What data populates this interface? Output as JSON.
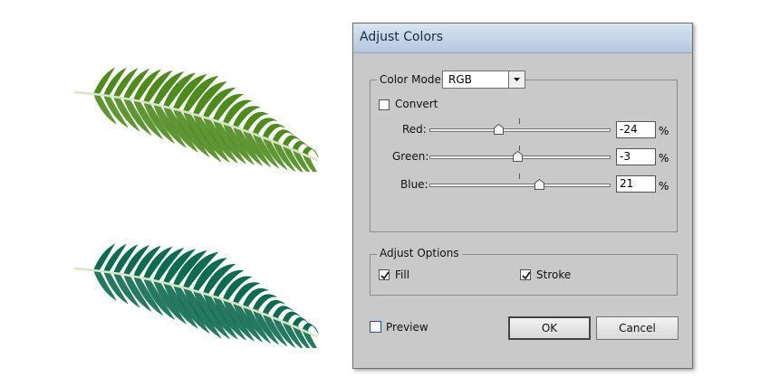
{
  "dialog": {
    "title": "Adjust Colors",
    "color_mode": {
      "label": "Color Mode:",
      "selected": "RGB",
      "convert_label": "Convert",
      "convert_checked": false,
      "channels": [
        {
          "label": "Red:",
          "value": "-24",
          "unit": "%",
          "level": -24
        },
        {
          "label": "Green:",
          "value": "-3",
          "unit": "%",
          "level": -3
        },
        {
          "label": "Blue:",
          "value": "21",
          "unit": "%",
          "level": 21
        }
      ]
    },
    "adjust_options": {
      "legend": "Adjust Options",
      "fill_label": "Fill",
      "fill_checked": true,
      "stroke_label": "Stroke",
      "stroke_checked": true
    },
    "preview_label": "Preview",
    "preview_checked": false,
    "ok_label": "OK",
    "cancel_label": "Cancel"
  },
  "artwork": {
    "top_leaf_color": "#4f8a1f",
    "bottom_leaf_color": "#0f6b4f"
  }
}
